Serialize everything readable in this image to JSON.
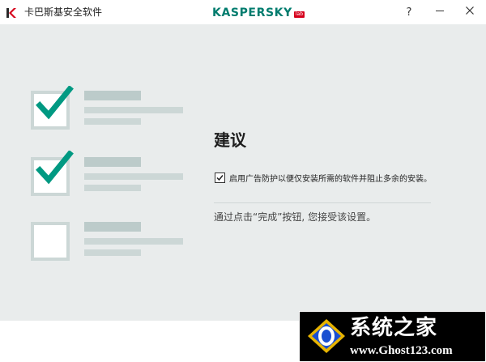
{
  "window": {
    "title": "卡巴斯基安全软件",
    "brand": "KASPERSKY",
    "brand_badge": "lab",
    "help_label": "?",
    "minimize_label": "—",
    "close_label": "✕"
  },
  "main": {
    "heading": "建议",
    "option": {
      "checked": true,
      "label": "启用广告防护以便仅安装所需的软件并阻止多余的安装。"
    },
    "note": "通过点击“完成”按钮, 您接受该设置。"
  },
  "illustration": {
    "items": [
      {
        "checked": true
      },
      {
        "checked": true
      },
      {
        "checked": false
      }
    ],
    "check_color": "#009982"
  },
  "watermark": {
    "title": "系统之家",
    "url": "www.Ghost123.com"
  },
  "colors": {
    "accent": "#009982",
    "brand": "#007c6e",
    "content_bg": "#e9ecec"
  }
}
